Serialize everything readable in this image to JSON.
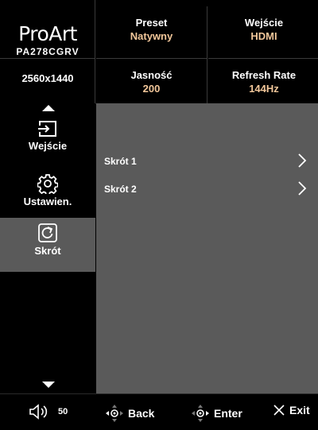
{
  "brand": {
    "logo": "ProArt",
    "model": "PA278CGRV",
    "resolution": "2560x1440"
  },
  "status": {
    "preset": {
      "label": "Preset",
      "value": "Natywny"
    },
    "input": {
      "label": "Wejście",
      "value": "HDMI"
    },
    "brightness": {
      "label": "Jasność",
      "value": "200"
    },
    "refresh": {
      "label": "Refresh Rate",
      "value": "144Hz"
    }
  },
  "sidebar": {
    "items": [
      {
        "label": "Wejście",
        "icon": "input-icon",
        "active": false
      },
      {
        "label": "Ustawien.",
        "icon": "gear-icon",
        "active": false
      },
      {
        "label": "Skrót",
        "icon": "shortcut-icon",
        "active": true
      }
    ]
  },
  "main": {
    "rows": [
      {
        "label": "Skrót 1"
      },
      {
        "label": "Skrót 2"
      }
    ]
  },
  "footer": {
    "volume": "50",
    "back": "Back",
    "enter": "Enter",
    "exit": "Exit"
  },
  "colors": {
    "accent": "#f2c79a",
    "panel": "#5a5a5a",
    "active_item": "#5a5a5a"
  }
}
